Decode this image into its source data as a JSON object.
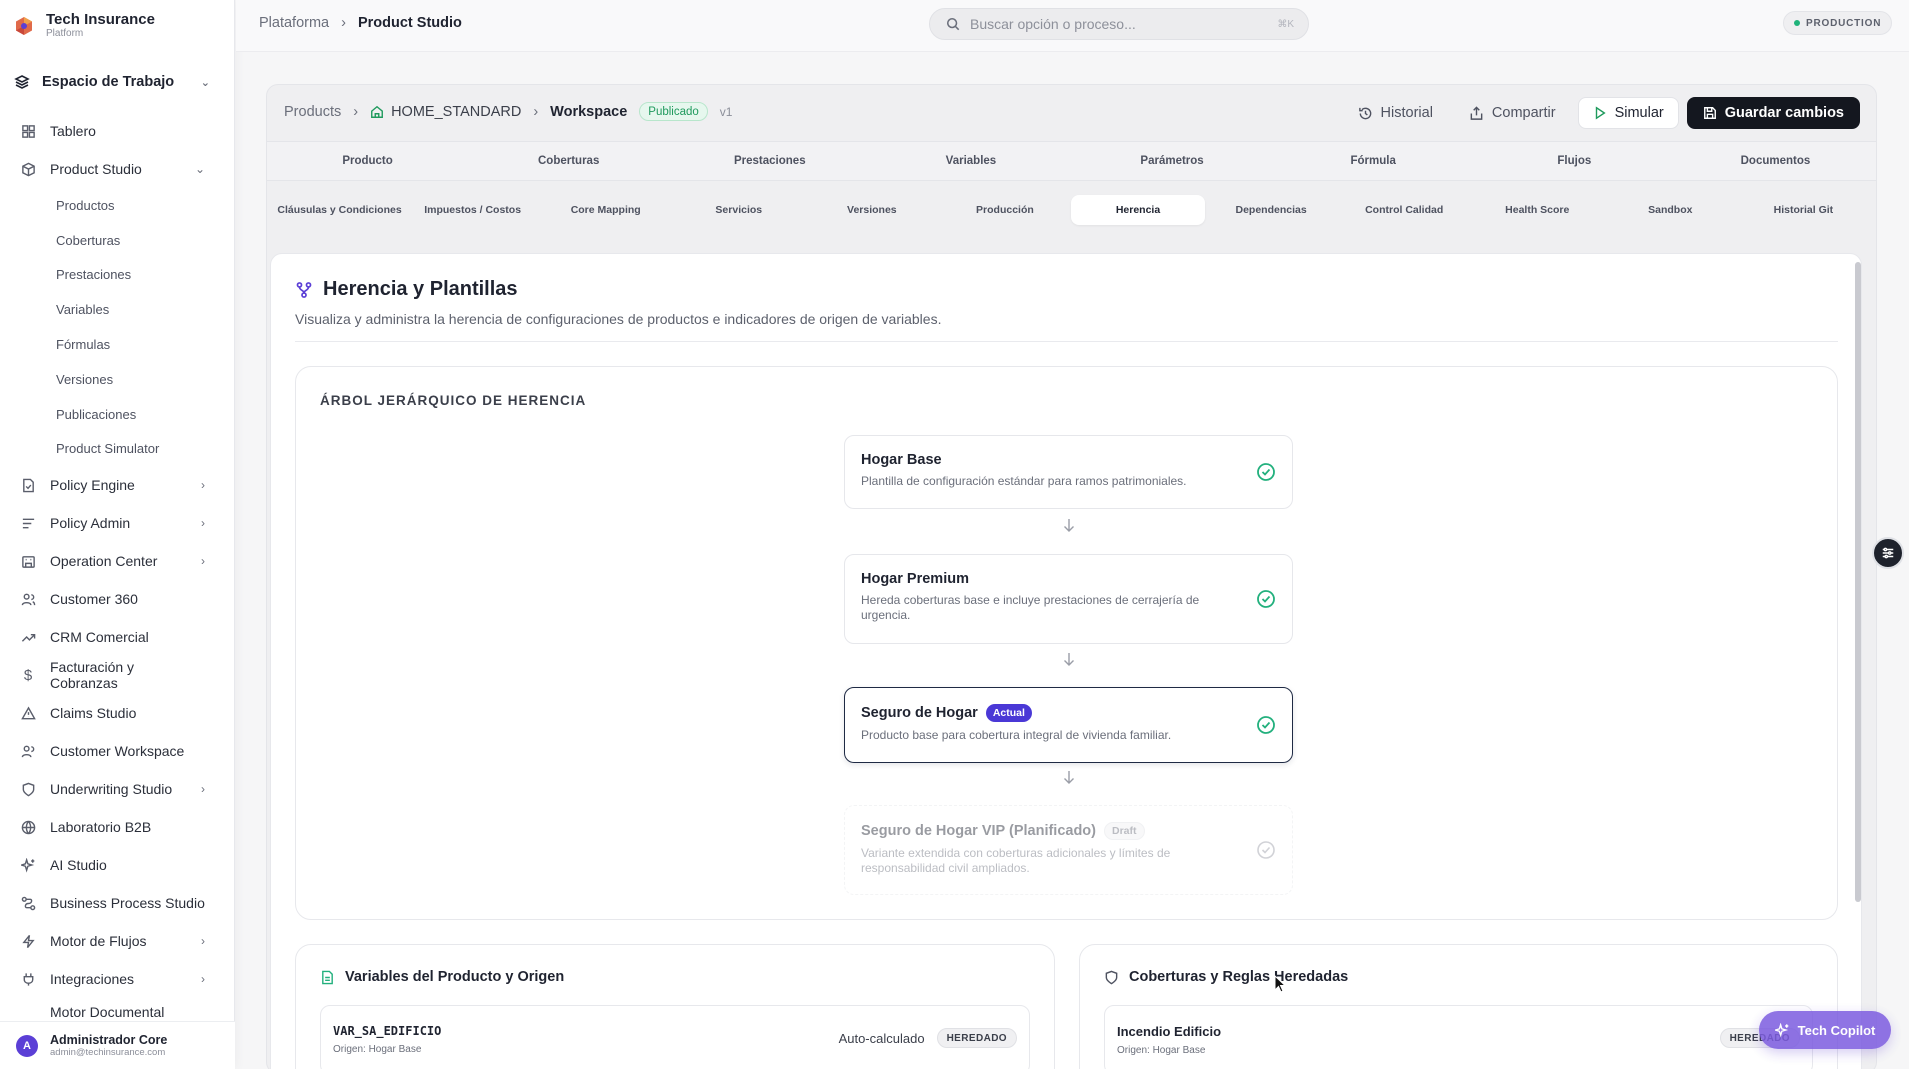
{
  "sidebar": {
    "brand_title": "Tech Insurance",
    "brand_sub": "Platform",
    "workspace": "Espacio de Trabajo",
    "items": [
      {
        "label": "Tablero",
        "icon": "grid-icon"
      },
      {
        "label": "Product Studio",
        "icon": "box-icon"
      },
      {
        "label": "Policy Engine",
        "icon": "file-check-icon"
      },
      {
        "label": "Policy Admin",
        "icon": "list-icon"
      },
      {
        "label": "Operation Center",
        "icon": "building-icon"
      },
      {
        "label": "Customer 360",
        "icon": "users-icon"
      },
      {
        "label": "CRM Comercial",
        "icon": "trending-up-icon"
      },
      {
        "label": "Facturación y Cobranzas",
        "icon": "dollar-icon"
      },
      {
        "label": "Claims Studio",
        "icon": "alert-triangle-icon"
      },
      {
        "label": "Customer Workspace",
        "icon": "users-icon"
      },
      {
        "label": "Underwriting Studio",
        "icon": "shield-icon"
      },
      {
        "label": "Laboratorio B2B",
        "icon": "globe-icon"
      },
      {
        "label": "AI Studio",
        "icon": "sparkles-icon"
      },
      {
        "label": "Business Process Studio",
        "icon": "workflow-icon"
      },
      {
        "label": "Motor de Flujos",
        "icon": "zap-icon"
      },
      {
        "label": "Integraciones",
        "icon": "plug-icon"
      },
      {
        "label": "Motor Documental",
        "icon": "doc-icon"
      }
    ],
    "sub_items": [
      "Productos",
      "Coberturas",
      "Prestaciones",
      "Variables",
      "Fórmulas",
      "Versiones",
      "Publicaciones",
      "Product Simulator"
    ],
    "user_name": "Administrador Core",
    "user_email": "admin@techinsurance.com",
    "user_initial": "A"
  },
  "topbar": {
    "crumb_root": "Plataforma",
    "crumb_current": "Product Studio",
    "search_placeholder": "Buscar opción o proceso...",
    "search_shortcut": "⌘K",
    "env_label": "PRODUCTION"
  },
  "workspace": {
    "crumb_products": "Products",
    "crumb_code": "HOME_STANDARD",
    "crumb_current": "Workspace",
    "status": "Publicado",
    "version": "v1",
    "actions": {
      "history": "Historial",
      "share": "Compartir",
      "simulate": "Simular",
      "save": "Guardar cambios"
    },
    "tabs_main": [
      "Producto",
      "Coberturas",
      "Prestaciones",
      "Variables",
      "Parámetros",
      "Fórmula",
      "Flujos",
      "Documentos"
    ],
    "tabs_sub": [
      "Cláusulas y Condiciones",
      "Impuestos / Costos",
      "Core Mapping",
      "Servicios",
      "Versiones",
      "Producción",
      "Herencia",
      "Dependencias",
      "Control Calidad",
      "Health Score",
      "Sandbox",
      "Historial Git"
    ],
    "active_sub_tab": "Herencia"
  },
  "section": {
    "title": "Herencia y Plantillas",
    "description": "Visualiza y administra la herencia de configuraciones de productos e indicadores de origen de variables.",
    "tree_title": "ÁRBOL JERÁRQUICO DE HERENCIA",
    "nodes": [
      {
        "name": "Hogar Base",
        "desc": "Plantilla de configuración estándar para ramos patrimoniales.",
        "tag": ""
      },
      {
        "name": "Hogar Premium",
        "desc": "Hereda coberturas base e incluye prestaciones de cerrajería de urgencia.",
        "tag": ""
      },
      {
        "name": "Seguro de Hogar",
        "desc": "Producto base para cobertura integral de vivienda familiar.",
        "tag": "Actual"
      },
      {
        "name": "Seguro de Hogar VIP (Planificado)",
        "desc": "Variante extendida con coberturas adicionales y límites de responsabilidad civil ampliados.",
        "tag": "Draft"
      }
    ]
  },
  "variables_card": {
    "title": "Variables del Producto y Origen",
    "row_name": "VAR_SA_EDIFICIO",
    "row_origin": "Origen: Hogar Base",
    "row_calc": "Auto-calculado",
    "row_badge": "HEREDADO"
  },
  "coverages_card": {
    "title": "Coberturas y Reglas Heredadas",
    "row_name": "Incendio Edificio",
    "row_origin": "Origen: Hogar Base",
    "row_badge": "HEREDADO"
  },
  "copilot_label": "Tech Copilot",
  "colors": {
    "accent": "#4a38d6",
    "dark": "#14171f",
    "success": "#1f9a5d",
    "check": "#22b07d"
  }
}
